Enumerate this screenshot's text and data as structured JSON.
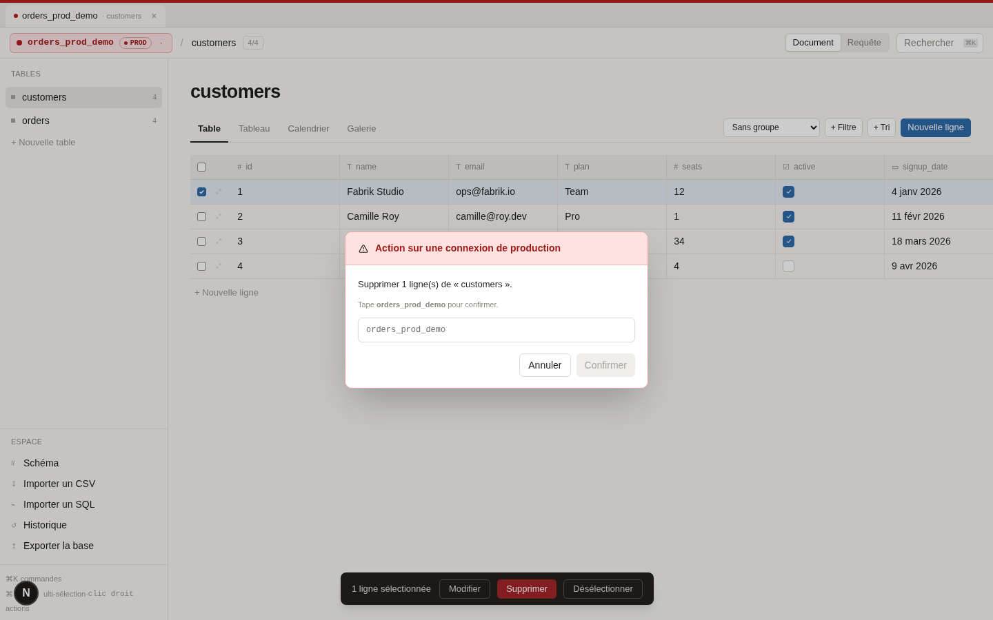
{
  "window_tab": {
    "title": "orders_prod_demo",
    "subtitle": "· customers",
    "close": "×"
  },
  "header": {
    "connection": {
      "name": "orders_prod_demo",
      "badge": "PROD",
      "menu": "·"
    },
    "separator": "/",
    "table": "customers",
    "count": "4/4",
    "modes": [
      {
        "label": "Document",
        "selected": true
      },
      {
        "label": "Requête",
        "selected": false
      }
    ],
    "search": {
      "placeholder": "Rechercher",
      "shortcut": "⌘K"
    }
  },
  "sidebar": {
    "tables_heading": "TABLES",
    "tables": [
      {
        "name": "customers",
        "count": "4",
        "selected": true
      },
      {
        "name": "orders",
        "count": "4",
        "selected": false
      }
    ],
    "new_table": "+ Nouvelle table",
    "space_heading": "ESPACE",
    "space_items": [
      {
        "icon": "#",
        "label": "Schéma"
      },
      {
        "icon": "↧",
        "label": "Importer un CSV"
      },
      {
        "icon": "⌁",
        "label": "Importer un SQL"
      },
      {
        "icon": "↺",
        "label": "Historique"
      },
      {
        "icon": "↥",
        "label": "Exporter la base"
      }
    ],
    "hints": {
      "line_1": "⌘K commandes",
      "line_2_start": "⌘",
      "line_2_text": "ulti-sélection·",
      "line_2_keys": "clic droit",
      "line_3": "actions"
    },
    "avatar": "N"
  },
  "main": {
    "title": "customers",
    "views": [
      {
        "label": "Table",
        "selected": true
      },
      {
        "label": "Tableau",
        "selected": false
      },
      {
        "label": "Calendrier",
        "selected": false
      },
      {
        "label": "Galerie",
        "selected": false
      }
    ],
    "group_select": "Sans groupe",
    "filter": "+ Filtre",
    "sort": "+ Tri",
    "new_row": "Nouvelle ligne",
    "table": {
      "all_checked": false,
      "columns": [
        {
          "icon": "#",
          "name": "id"
        },
        {
          "icon": "T",
          "name": "name"
        },
        {
          "icon": "T",
          "name": "email"
        },
        {
          "icon": "T",
          "name": "plan"
        },
        {
          "icon": "#",
          "name": "seats"
        },
        {
          "icon": "☑",
          "name": "active"
        },
        {
          "icon": "▭",
          "name": "signup_date"
        }
      ],
      "rows": [
        {
          "selected": true,
          "id": "1",
          "name": "Fabrik Studio",
          "email": "ops@fabrik.io",
          "plan": "Team",
          "seats": "12",
          "active": true,
          "signup_date": "4 janv 2026"
        },
        {
          "selected": false,
          "id": "2",
          "name": "Camille Roy",
          "email": "camille@roy.dev",
          "plan": "Pro",
          "seats": "1",
          "active": true,
          "signup_date": "11 févr 2026"
        },
        {
          "selected": false,
          "id": "3",
          "seats": "34",
          "active": true,
          "signup_date": "18 mars 2026"
        },
        {
          "selected": false,
          "id": "4",
          "seats": "4",
          "active": false,
          "signup_date": "9 avr 2026"
        }
      ],
      "new_row": "+ Nouvelle ligne"
    }
  },
  "selection_bar": {
    "count": "1 ligne sélectionnée",
    "buttons": [
      {
        "label": "Modifier",
        "kind": "outline"
      },
      {
        "label": "Supprimer",
        "kind": "danger"
      },
      {
        "label": "Désélectionner",
        "kind": "outline"
      }
    ]
  },
  "dialog": {
    "title": "Action sur une connexion de production",
    "message": "Supprimer 1 ligne(s) de « customers ».",
    "hint": "Tape **orders_prod_demo** pour confirmer.",
    "placeholder": "orders_prod_demo",
    "cancel": "Annuler",
    "confirm": {
      "label": "Confirmer",
      "disabled": true
    }
  }
}
